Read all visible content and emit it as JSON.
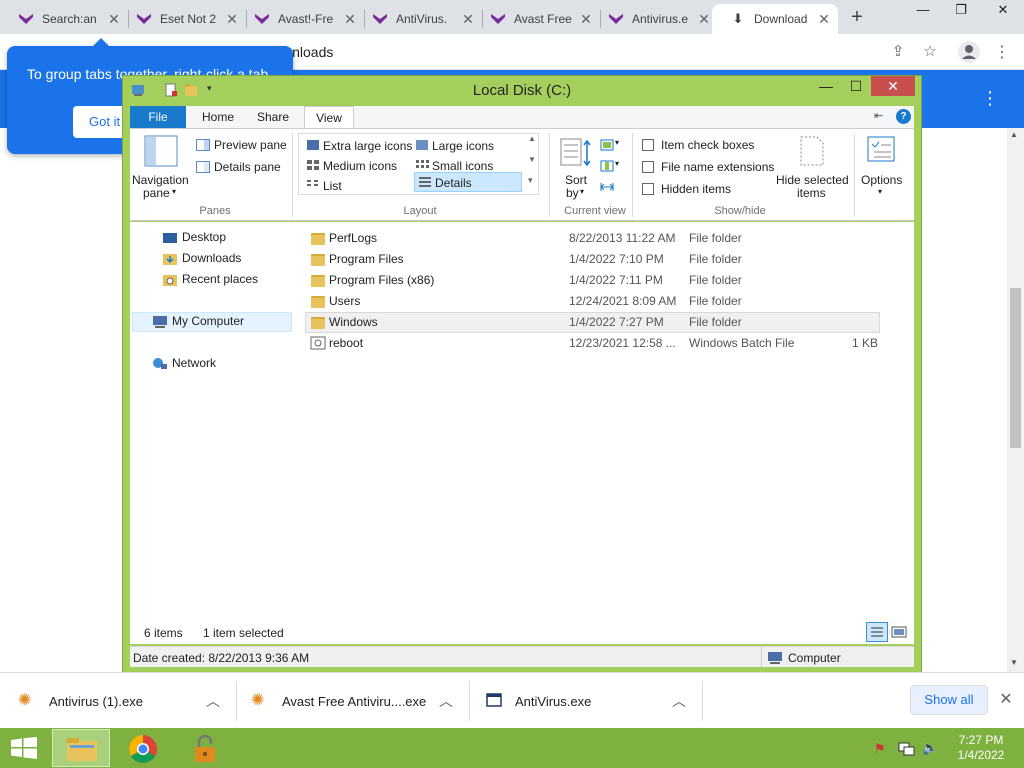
{
  "browser": {
    "tabs": [
      {
        "title": "Search:an",
        "active": false
      },
      {
        "title": "Eset Not 2",
        "active": false
      },
      {
        "title": "Avast!-Fre",
        "active": false
      },
      {
        "title": "AntiVirus.",
        "active": false
      },
      {
        "title": "Avast Free",
        "active": false
      },
      {
        "title": "Antivirus.e",
        "active": false
      },
      {
        "title": "Download",
        "active": true
      }
    ],
    "address_text": "wnloads",
    "tooltip": {
      "text": "To group tabs together, right-click a tab",
      "button": "Got it"
    },
    "colors": {
      "accent": "#1a73e8"
    }
  },
  "explorer": {
    "title": "Local Disk (C:)",
    "ribbon_tabs": [
      "File",
      "Home",
      "Share",
      "View"
    ],
    "panes": {
      "navigation": "Navigation",
      "navigation2": "pane",
      "preview": "Preview pane",
      "details": "Details pane",
      "group": "Panes"
    },
    "layout": {
      "extra_large": "Extra large icons",
      "large": "Large icons",
      "medium": "Medium icons",
      "small": "Small icons",
      "list": "List",
      "details": "Details",
      "group": "Layout"
    },
    "current_view": {
      "sort": "Sort",
      "sort2": "by",
      "group": "Current view"
    },
    "show_hide": {
      "item_check_boxes": "Item check boxes",
      "file_name_extensions": "File name extensions",
      "hidden_items": "Hidden items",
      "hide_selected": "Hide selected",
      "hide_selected2": "items",
      "group": "Show/hide"
    },
    "options": "Options",
    "nav": {
      "desktop": "Desktop",
      "downloads": "Downloads",
      "recent": "Recent places",
      "my_computer": "My Computer",
      "network": "Network"
    },
    "files": [
      {
        "name": "PerfLogs",
        "date": "8/22/2013 11:22 AM",
        "type": "File folder",
        "size": ""
      },
      {
        "name": "Program Files",
        "date": "1/4/2022 7:10 PM",
        "type": "File folder",
        "size": ""
      },
      {
        "name": "Program Files (x86)",
        "date": "1/4/2022 7:11 PM",
        "type": "File folder",
        "size": ""
      },
      {
        "name": "Users",
        "date": "12/24/2021 8:09 AM",
        "type": "File folder",
        "size": ""
      },
      {
        "name": "Windows",
        "date": "1/4/2022 7:27 PM",
        "type": "File folder",
        "size": ""
      },
      {
        "name": "reboot",
        "date": "12/23/2021 12:58 ...",
        "type": "Windows Batch File",
        "size": "1 KB"
      }
    ],
    "status": {
      "count": "6 items",
      "selected": "1 item selected",
      "date_created": "Date created: 8/22/2013 9:36 AM",
      "location": "Computer"
    }
  },
  "downloads_bar": {
    "items": [
      {
        "name": "Antivirus (1).exe"
      },
      {
        "name": "Avast Free Antiviru....exe"
      },
      {
        "name": "AntiVirus.exe"
      }
    ],
    "show_all": "Show all"
  },
  "taskbar": {
    "time": "7:27 PM",
    "date": "1/4/2022"
  }
}
